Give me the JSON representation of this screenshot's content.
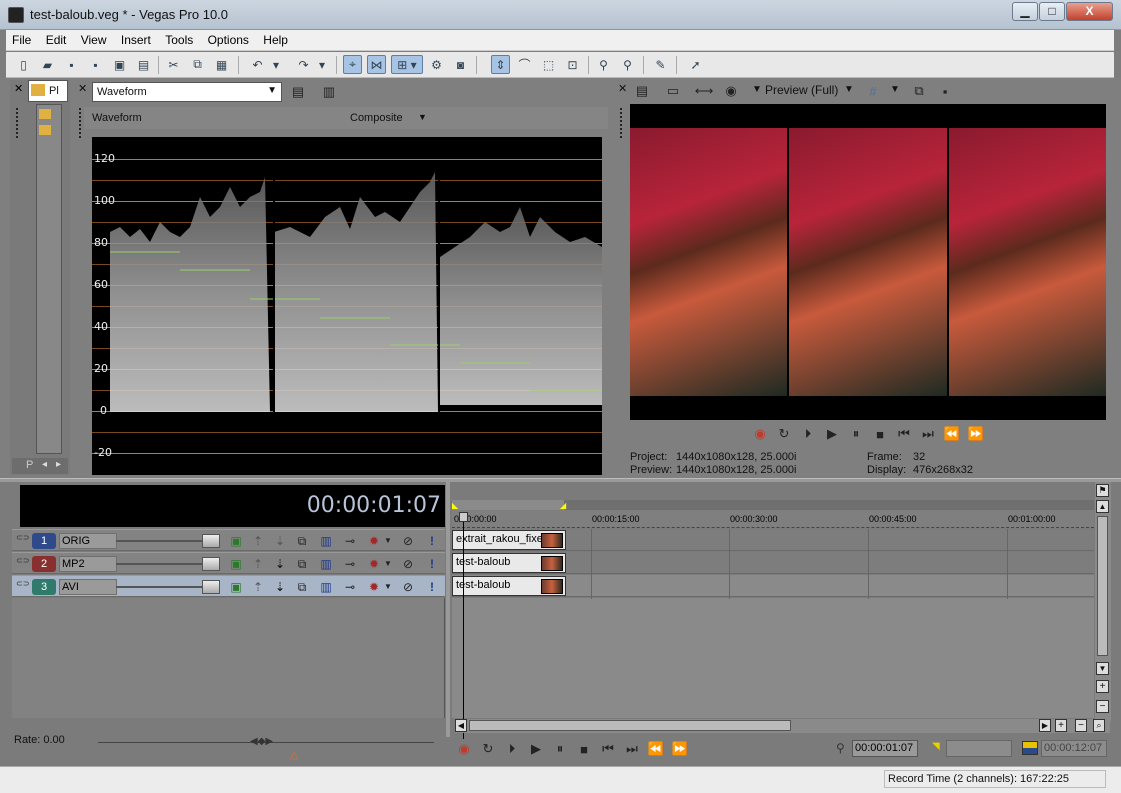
{
  "window": {
    "title": "test-baloub.veg * - Vegas Pro 10.0",
    "controls": {
      "minimize": "▁",
      "maximize": "□",
      "close": "X"
    }
  },
  "menu": [
    "File",
    "Edit",
    "View",
    "Insert",
    "Tools",
    "Options",
    "Help"
  ],
  "explorer": {
    "tab_label": "Pl",
    "tab_bottom": "P"
  },
  "scope": {
    "type_select": "Waveform",
    "panel_title": "Waveform",
    "mode_select": "Composite",
    "y_ticks": [
      "120",
      "100",
      "80",
      "60",
      "40",
      "20",
      "0",
      "-20"
    ]
  },
  "preview": {
    "quality": "Preview (Full)",
    "project_label": "Project:",
    "project_value": "1440x1080x128, 25.000i",
    "preview_label": "Preview:",
    "preview_value": "1440x1080x128, 25.000i",
    "frame_label": "Frame:",
    "frame_value": "32",
    "display_label": "Display:",
    "display_value": "476x268x32"
  },
  "timecode": "00:00:01:07",
  "ruler": [
    "0:00:00:00",
    "00:00:15:00",
    "00:00:30:00",
    "00:00:45:00",
    "00:01:00:00"
  ],
  "tracks": [
    {
      "num": "1",
      "name": "ORIG",
      "color": "#2f4a8a",
      "clip": "extrait_rakou_fixed"
    },
    {
      "num": "2",
      "name": "MP2",
      "color": "#8a2f2f",
      "clip": "test-baloub"
    },
    {
      "num": "3",
      "name": "AVI",
      "color": "#2f7a6a",
      "clip": "test-baloub"
    }
  ],
  "rate": "Rate: 0.00",
  "transport": {
    "cursor_time": "00:00:01:07",
    "end_time": "00:00:12:07"
  },
  "status": {
    "record_time": "Record Time (2 channels): 167:22:25"
  },
  "colors": {
    "accent": "#a7b5c7",
    "timecode_bg": "#000000",
    "grid_orange": "#c8762a"
  }
}
